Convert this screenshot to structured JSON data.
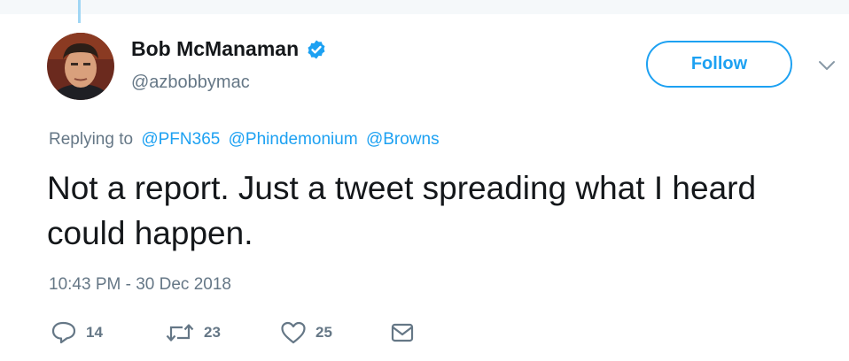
{
  "tweet": {
    "author": {
      "display_name": "Bob McManaman",
      "handle": "@azbobbymac",
      "verified": true
    },
    "follow_label": "Follow",
    "replying": {
      "prefix": "Replying to",
      "mentions": [
        "@PFN365",
        "@Phindemonium",
        "@Browns"
      ]
    },
    "text": "Not a report. Just a tweet spreading what I heard could happen.",
    "timestamp": "10:43 PM - 30 Dec 2018",
    "actions": {
      "replies": "14",
      "retweets": "23",
      "likes": "25"
    }
  },
  "colors": {
    "accent": "#1da1f2",
    "muted": "#657786",
    "text": "#14171a",
    "thread_line": "#a0d6f4"
  },
  "icons": {
    "verified": "verified-badge-icon",
    "caret": "chevron-down-icon",
    "reply": "reply-bubble-icon",
    "retweet": "retweet-icon",
    "like": "heart-icon",
    "dm": "envelope-icon"
  }
}
